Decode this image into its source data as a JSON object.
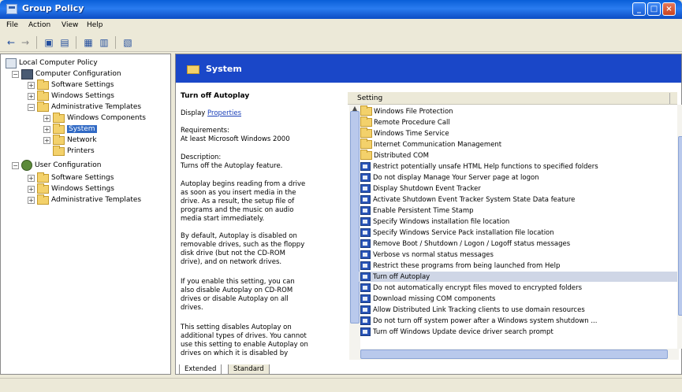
{
  "window": {
    "title": "Group Policy"
  },
  "menu": [
    "File",
    "Action",
    "View",
    "Help"
  ],
  "tree": [
    {
      "label": "Local Computer Policy"
    },
    {
      "label": "Computer Configuration"
    },
    {
      "label": "Software Settings"
    },
    {
      "label": "Windows Settings"
    },
    {
      "label": "Administrative Templates"
    },
    {
      "label": "Windows Components"
    },
    {
      "label": "System"
    },
    {
      "label": "Network"
    },
    {
      "label": "Printers"
    },
    {
      "label": "User Configuration"
    },
    {
      "label": "Software Settings"
    },
    {
      "label": "Windows Settings"
    },
    {
      "label": "Administrative Templates"
    }
  ],
  "header": {
    "title": "System"
  },
  "description": {
    "title": "Turn off Autoplay",
    "display_prefix": "Display",
    "display_link": "Properties",
    "lines": [
      "Requirements:",
      "At least Microsoft Windows 2000",
      "Description:",
      "Turns off the Autoplay feature.",
      "Autoplay begins reading from a drive",
      "as soon as you insert media in the",
      "drive. As a result, the setup file of",
      "programs and the music on audio",
      "media start immediately.",
      "By default, Autoplay is disabled on",
      "removable drives, such as the floppy",
      "disk drive (but not the CD-ROM",
      "drive), and on network drives.",
      "If you enable this setting, you can",
      "also disable Autoplay on CD-ROM",
      "drives or disable Autoplay on all",
      "drives.",
      "This setting disables Autoplay on",
      "additional types of drives. You cannot",
      "use this setting to enable Autoplay on",
      "drives on which it is disabled by"
    ]
  },
  "list": {
    "column": "Setting",
    "items": [
      {
        "label": "Windows File Protection",
        "kind": "folder"
      },
      {
        "label": "Remote Procedure Call",
        "kind": "folder"
      },
      {
        "label": "Windows Time Service",
        "kind": "folder"
      },
      {
        "label": "Internet Communication Management",
        "kind": "folder"
      },
      {
        "label": "Distributed COM",
        "kind": "folder"
      },
      {
        "label": "Restrict potentially unsafe HTML Help functions to specified folders",
        "kind": "setting"
      },
      {
        "label": "Do not display Manage Your Server page at logon",
        "kind": "setting"
      },
      {
        "label": "Display Shutdown Event Tracker",
        "kind": "setting"
      },
      {
        "label": "Activate Shutdown Event Tracker System State Data feature",
        "kind": "setting"
      },
      {
        "label": "Enable Persistent Time Stamp",
        "kind": "setting"
      },
      {
        "label": "Specify Windows installation file location",
        "kind": "setting"
      },
      {
        "label": "Specify Windows Service Pack installation file location",
        "kind": "setting"
      },
      {
        "label": "Remove Boot / Shutdown / Logon / Logoff status messages",
        "kind": "setting"
      },
      {
        "label": "Verbose vs normal status messages",
        "kind": "setting"
      },
      {
        "label": "Restrict these programs from being launched from Help",
        "kind": "setting"
      },
      {
        "label": "Turn off Autoplay",
        "kind": "setting"
      },
      {
        "label": "Do not automatically encrypt files moved to encrypted folders",
        "kind": "setting"
      },
      {
        "label": "Download missing COM components",
        "kind": "setting"
      },
      {
        "label": "Allow Distributed Link Tracking clients to use domain resources",
        "kind": "setting"
      },
      {
        "label": "Do not turn off system power after a Windows system shutdown ...",
        "kind": "setting"
      },
      {
        "label": "Turn off Windows Update device driver search prompt",
        "kind": "setting"
      }
    ]
  },
  "tabs": [
    "Extended",
    "Standard"
  ]
}
